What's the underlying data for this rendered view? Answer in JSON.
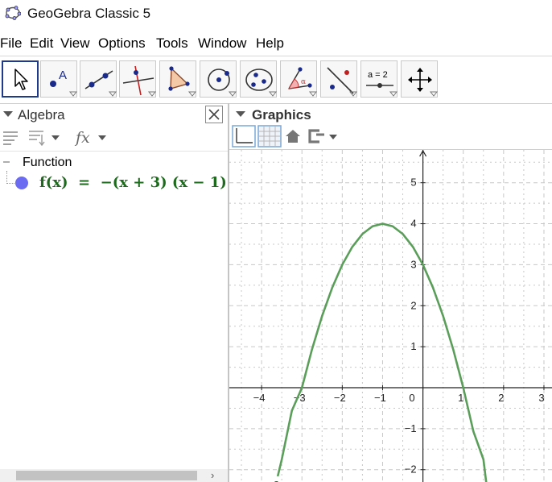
{
  "window": {
    "title": "GeoGebra Classic 5"
  },
  "menu": [
    "File",
    "Edit",
    "View",
    "Options",
    "Tools",
    "Window",
    "Help"
  ],
  "toolbar": {
    "tools": [
      "move-tool",
      "point-tool",
      "line-tool",
      "perpendicular-tool",
      "polygon-tool",
      "circle-tool",
      "ellipse-tool",
      "angle-tool",
      "reflect-tool",
      "slider-tool",
      "move-graphics-tool"
    ],
    "selected": "move-tool",
    "slider_label": "a = 2"
  },
  "algebra": {
    "title": "Algebra",
    "category": "Function",
    "items": [
      {
        "label": "f(x)  =  −(x + 3) (x − 1)",
        "color": "#1e6b1e",
        "dot_color": "#6b6bf2"
      }
    ]
  },
  "graphics": {
    "title": "Graphics",
    "chart_data": {
      "type": "line",
      "function": "f(x) = -(x + 3)(x - 1)",
      "xlim": [
        -4.8,
        3.2
      ],
      "ylim": [
        -2.3,
        5.8
      ],
      "x_ticks": [
        -4,
        -3,
        -2,
        -1,
        0,
        1,
        2,
        3
      ],
      "y_ticks": [
        -2,
        -1,
        1,
        2,
        3,
        4,
        5
      ],
      "grid": true,
      "series": [
        {
          "name": "f",
          "color": "#5a9e5a",
          "x": [
            -3.6,
            -3.5,
            -3.25,
            -3,
            -2.75,
            -2.5,
            -2.25,
            -2,
            -1.75,
            -1.5,
            -1.25,
            -1,
            -0.75,
            -0.5,
            -0.25,
            0,
            0.25,
            0.5,
            0.75,
            1,
            1.25,
            1.5,
            1.6
          ],
          "y": [
            -2.16,
            -1.75,
            -0.5625,
            0,
            0.9375,
            1.75,
            2.4375,
            3,
            3.4375,
            3.75,
            3.9375,
            4,
            3.9375,
            3.75,
            3.4375,
            3,
            2.4375,
            1.75,
            0.9375,
            0,
            -1.0625,
            -1.75,
            -2.56
          ]
        }
      ]
    }
  }
}
